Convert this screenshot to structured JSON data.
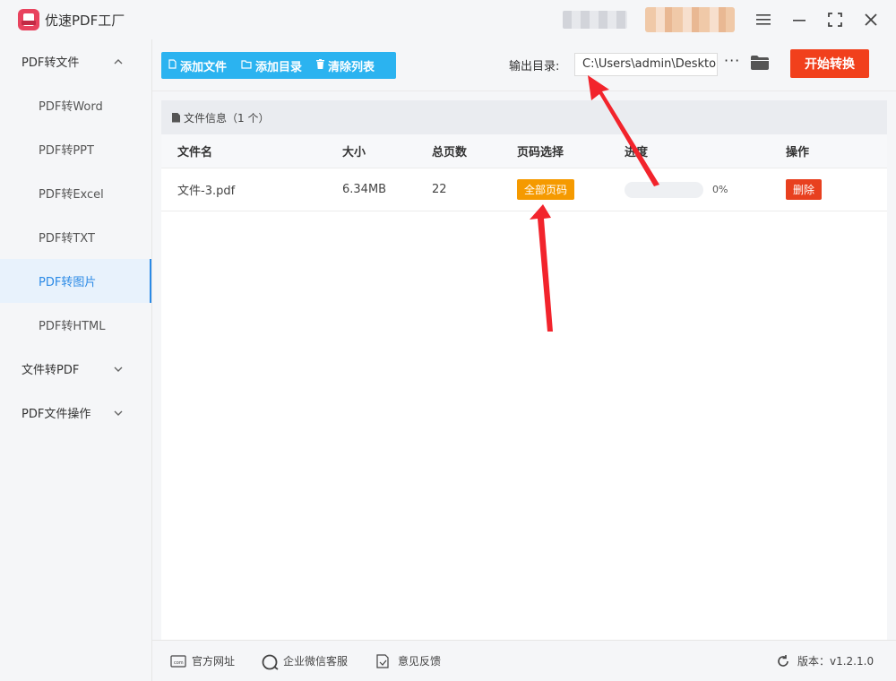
{
  "app": {
    "title": "优速PDF工厂"
  },
  "window": {
    "menu_icon": "menu-icon",
    "minimize_icon": "minimize-icon",
    "maximize_icon": "maximize-icon",
    "close_icon": "close-icon"
  },
  "sidebar": {
    "groups": [
      {
        "label": "PDF转文件",
        "expanded": true,
        "items": [
          "PDF转Word",
          "PDF转PPT",
          "PDF转Excel",
          "PDF转TXT",
          "PDF转图片",
          "PDF转HTML"
        ]
      },
      {
        "label": "文件转PDF",
        "expanded": false
      },
      {
        "label": "PDF文件操作",
        "expanded": false
      }
    ],
    "active_item": "PDF转图片"
  },
  "toolbar": {
    "add_file": "添加文件",
    "add_folder": "添加目录",
    "clear_list": "清除列表",
    "output_label": "输出目录:",
    "output_value": "C:\\Users\\admin\\Deskto",
    "more": "···",
    "start": "开始转换"
  },
  "file_panel": {
    "title": "文件信息（1 个）",
    "columns": [
      "文件名",
      "大小",
      "总页数",
      "页码选择",
      "进度",
      "操作"
    ],
    "rows": [
      {
        "name": "文件-3.pdf",
        "size": "6.34MB",
        "pages": "22",
        "page_select": "全部页码",
        "progress": 0,
        "progress_label": "0%",
        "action": "删除"
      }
    ]
  },
  "footer": {
    "website": "官方网址",
    "wechat": "企业微信客服",
    "feedback": "意见反馈",
    "version": "版本：v1.2.1.0"
  },
  "colors": {
    "accent": "#2bb3f0",
    "start": "#f1401c",
    "badge": "#f59a00",
    "delete": "#e8401f",
    "annotation_arrow": "#f2242c"
  }
}
